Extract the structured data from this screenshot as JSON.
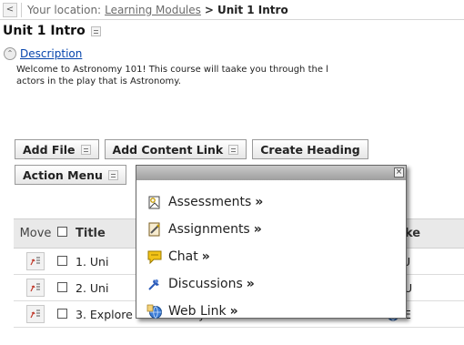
{
  "breadcrumb": {
    "back_label": "<",
    "prefix": "Your location:",
    "link": "Learning Modules",
    "separator": ">",
    "current": "Unit 1 Intro"
  },
  "page": {
    "title": "Unit 1 Intro"
  },
  "description": {
    "toggle_label": "Description",
    "text_line1": "Welcome to Astronomy 101! This course will taake you through the l",
    "text_line2": "actors in the play that is Astronomy."
  },
  "toolbar": {
    "add_file": "Add File",
    "add_content_link": "Add Content Link",
    "create_heading": "Create Heading",
    "action_menu": "Action Menu"
  },
  "table": {
    "headers": {
      "move": "Move",
      "title": "Title",
      "link": "Linke"
    },
    "rows": [
      {
        "title": "1. Uni",
        "link_text": "U"
      },
      {
        "title": "2. Uni",
        "link_text": "U"
      },
      {
        "title": "3. Explore our Solar System",
        "link_text": "E"
      }
    ]
  },
  "popup": {
    "close_label": "×",
    "items": [
      {
        "label": "Assessments",
        "more": "»",
        "icon": "assessments-icon"
      },
      {
        "label": "Assignments",
        "more": "»",
        "icon": "assignments-icon"
      },
      {
        "label": "Chat",
        "more": "»",
        "icon": "chat-icon"
      },
      {
        "label": "Discussions",
        "more": "»",
        "icon": "discussions-icon"
      },
      {
        "label": "Web Link",
        "more": "»",
        "icon": "web-link-icon"
      }
    ]
  },
  "colors": {
    "link_blue": "#0645ad",
    "popup_border": "#666666",
    "chat_yellow": "#e9b400",
    "discussion_blue": "#2a5ab8"
  }
}
